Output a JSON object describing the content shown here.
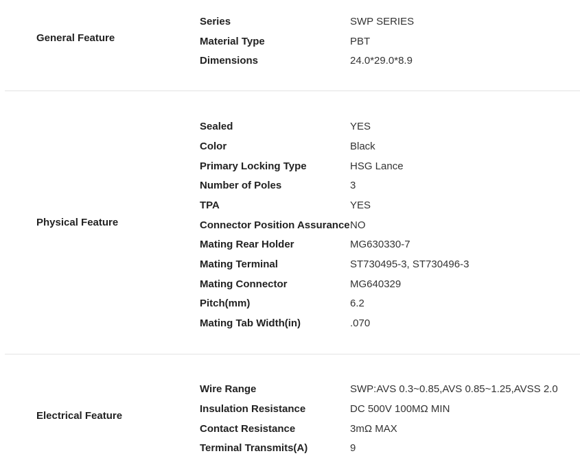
{
  "sections": [
    {
      "title": "General Feature",
      "rows": [
        {
          "label": "Series",
          "value": "SWP SERIES"
        },
        {
          "label": "Material Type",
          "value": "PBT"
        },
        {
          "label": "Dimensions",
          "value": "24.0*29.0*8.9"
        }
      ]
    },
    {
      "title": "Physical Feature",
      "rows": [
        {
          "label": "Sealed",
          "value": "YES"
        },
        {
          "label": "Color",
          "value": "Black"
        },
        {
          "label": "Primary Locking Type",
          "value": "HSG Lance"
        },
        {
          "label": "Number of Poles",
          "value": "3"
        },
        {
          "label": "TPA",
          "value": "YES"
        },
        {
          "label": "Connector Position Assurance",
          "value": "NO"
        },
        {
          "label": "Mating Rear Holder",
          "value": "MG630330-7"
        },
        {
          "label": "Mating Terminal",
          "value": "ST730495-3, ST730496-3"
        },
        {
          "label": "Mating Connector",
          "value": "MG640329"
        },
        {
          "label": "Pitch(mm)",
          "value": "6.2"
        },
        {
          "label": "Mating Tab Width(in)",
          "value": ".070"
        }
      ]
    },
    {
      "title": "Electrical Feature",
      "rows": [
        {
          "label": "Wire Range",
          "value": "SWP:AVS 0.3~0.85,AVS 0.85~1.25,AVSS 2.0"
        },
        {
          "label": "Insulation Resistance",
          "value": "DC 500V 100MΩ MIN"
        },
        {
          "label": "Contact Resistance",
          "value": "3mΩ MAX"
        },
        {
          "label": "Terminal Transmits(A)",
          "value": "9"
        }
      ]
    }
  ]
}
